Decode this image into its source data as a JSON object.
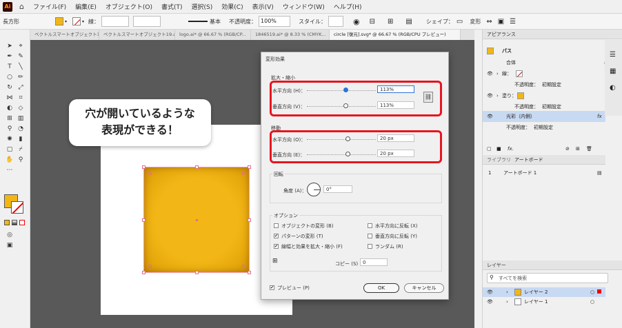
{
  "menubar": {
    "logo": "Ai",
    "items": [
      "ファイル(F)",
      "編集(E)",
      "オブジェクト(O)",
      "書式(T)",
      "選択(S)",
      "効果(C)",
      "表示(V)",
      "ウィンドウ(W)",
      "ヘルプ(H)"
    ]
  },
  "controlbar": {
    "object_type": "長方形",
    "stroke_label": "線：",
    "stroke_style": "基本",
    "opacity_label": "不透明度：",
    "opacity_value": "100%",
    "style_label": "スタイル：",
    "shape_label": "シェイプ：",
    "transform_label": "変形"
  },
  "tabs": [
    "ベクトルスマートオブジェクト12.ai",
    "ベクトルスマートオブジェクト19.ai",
    "logo.ai* @ 66.67 % (RGB/CP...",
    "1846519.ai* @ 8.33 % (CMYK...",
    "circle [復元].svg* @ 66.67 % (RGB/CPU プレビュー)"
  ],
  "callout": {
    "line1": "穴が開いているような",
    "line2": "表現ができる！"
  },
  "dialog": {
    "title": "変形効果",
    "scale_label": "拡大・縮小",
    "horizontal_label": "水平方向 (H)：",
    "horizontal_value": "113%",
    "vertical_label": "垂直方向 (V)：",
    "vertical_value": "113%",
    "move_label": "移動",
    "move_h_label": "水平方向 (O)：",
    "move_h_value": "20 px",
    "move_v_label": "垂直方向 (E)：",
    "move_v_value": "20 px",
    "rotate_label": "回転",
    "angle_label": "角度 (A)：",
    "angle_value": "0°",
    "options_label": "オプション",
    "opt_transform_objects": "オブジェクトの変形 (B)",
    "opt_transform_patterns": "パターンの変形 (T)",
    "opt_scale_strokes": "線幅と効果を拡大・縮小 (F)",
    "opt_reflect_x": "水平方向に反転 (X)",
    "opt_reflect_y": "垂直方向に反転 (Y)",
    "opt_random": "ランダム (R)",
    "copies_label": "コピー (S)",
    "copies_value": "0",
    "preview_label": "プレビュー (P)",
    "ok_label": "OK",
    "cancel_label": "キャンセル"
  },
  "appearance": {
    "panel_title": "アピアランス",
    "object_label": "パス",
    "blend_label": "合体",
    "stroke_label": "線：",
    "opacity_label": "不透明度：",
    "opacity_value": "初期設定",
    "fill_label": "塗り：",
    "fill_opacity_label": "不透明度：",
    "fill_opacity_value": "初期設定",
    "effect_label": "光彩（内側）",
    "effect_opacity_label": "不透明度：",
    "effect_opacity_value": "初期設定"
  },
  "libraries": {
    "tab_library": "ライブラリ",
    "tab_artboard": "アートボード",
    "row_number": "1",
    "row_name": "アートボード 1"
  },
  "layers": {
    "panel_title": "レイヤー",
    "search_placeholder": "すべてを検索",
    "layer2": "レイヤー 2",
    "layer1": "レイヤー 1"
  },
  "colors": {
    "accent_orange": "#f2b716",
    "highlight_red": "#e8141e",
    "selection_blue": "#c8d9f2"
  }
}
